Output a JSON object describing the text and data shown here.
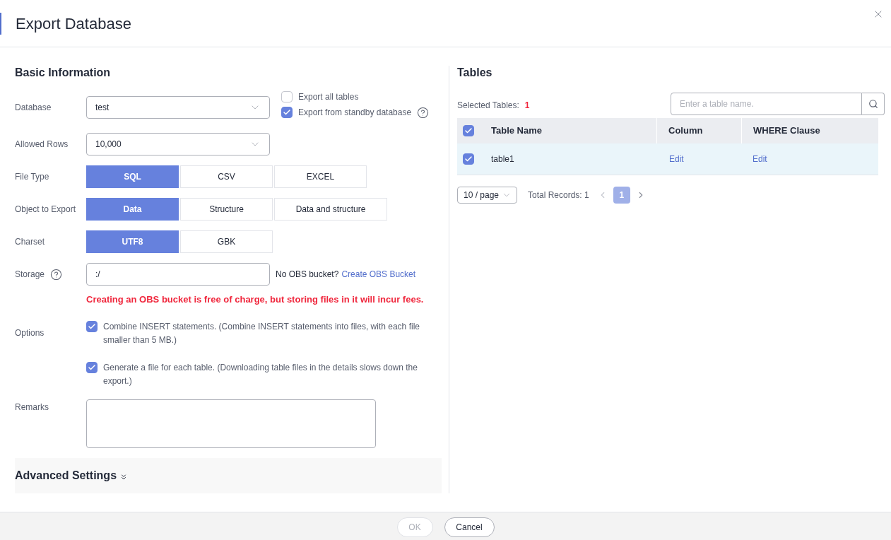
{
  "dialog": {
    "title": "Export Database"
  },
  "basic": {
    "heading": "Basic Information",
    "fields": [
      {
        "kind": "select",
        "label": "Database",
        "value": "test",
        "checks": [
          {
            "label": "Export all tables",
            "checked": false,
            "help": false
          },
          {
            "label": "Export from standby database",
            "checked": true,
            "help": true
          }
        ]
      },
      {
        "kind": "select",
        "label": "Allowed Rows",
        "value": "10,000"
      },
      {
        "kind": "segmented",
        "label": "File Type",
        "options": [
          {
            "label": "SQL",
            "selected": true
          },
          {
            "label": "CSV",
            "selected": false
          },
          {
            "label": "EXCEL",
            "selected": false
          }
        ]
      },
      {
        "kind": "segmented",
        "label": "Object to Export",
        "options": [
          {
            "label": "Data",
            "selected": true
          },
          {
            "label": "Structure",
            "selected": false
          },
          {
            "label": "Data and structure",
            "selected": false
          }
        ]
      },
      {
        "kind": "segmented",
        "label": "Charset",
        "options": [
          {
            "label": "UTF8",
            "selected": true
          },
          {
            "label": "GBK",
            "selected": false
          }
        ]
      },
      {
        "kind": "storage",
        "label": "Storage",
        "help": true,
        "value": ":/",
        "note": "No OBS bucket?",
        "link": "Create OBS Bucket",
        "warning": "Creating an OBS bucket is free of charge, but storing files in it will incur fees."
      },
      {
        "kind": "options",
        "label": "Options",
        "checks": [
          {
            "label": "Combine INSERT statements. (Combine INSERT statements into files, with each file smaller than 5 MB.)",
            "checked": true
          },
          {
            "label": "Generate a file for each table. (Downloading table files in the details slows down the export.)",
            "checked": true
          }
        ]
      },
      {
        "kind": "textarea",
        "label": "Remarks"
      }
    ],
    "advanced": "Advanced Settings"
  },
  "tables": {
    "heading": "Tables",
    "selected_label": "Selected Tables:",
    "selected_count": "1",
    "search": {
      "placeholder": "Enter a table name."
    },
    "columns": [
      "Table Name",
      "Column",
      "WHERE Clause"
    ],
    "all_checked": true,
    "rows": [
      {
        "checked": true,
        "name": "table1",
        "column": "Edit",
        "where": "Edit"
      }
    ],
    "page_size": "10 / page",
    "total": "Total Records: 1",
    "pages": [
      {
        "label": "1",
        "selected": true
      }
    ]
  },
  "footer": {
    "buttons": [
      {
        "label": "OK",
        "disabled": true
      },
      {
        "label": "Cancel",
        "disabled": false
      }
    ]
  }
}
